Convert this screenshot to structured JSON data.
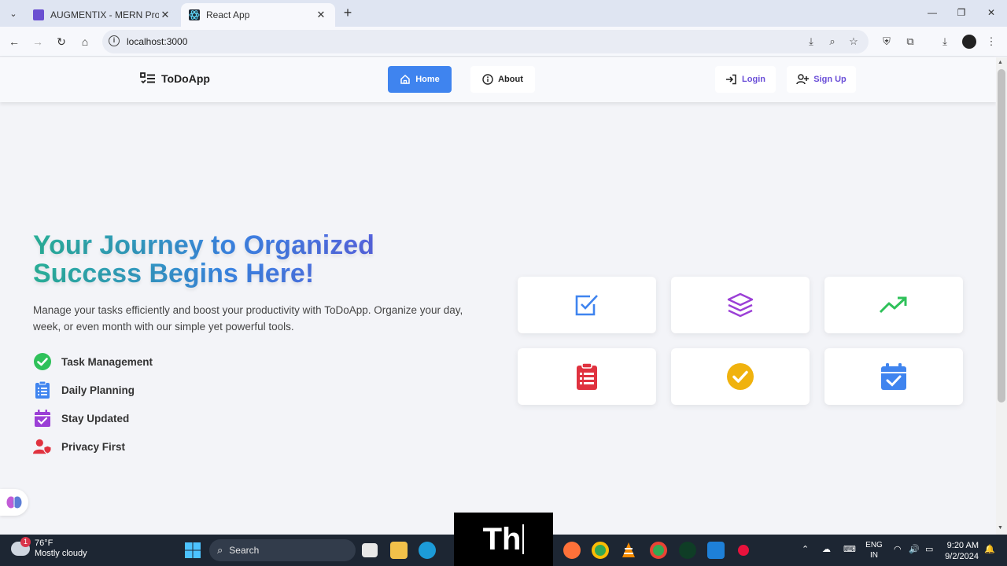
{
  "browser": {
    "tabs": [
      {
        "title": "AUGMENTIX - MERN Project Su",
        "active": false,
        "favicon_color": "#6a4fd1"
      },
      {
        "title": "React App",
        "active": true,
        "favicon_color": "#1e2a36"
      }
    ],
    "url": "localhost:3000"
  },
  "app": {
    "brand": "ToDoApp",
    "nav": {
      "home": "Home",
      "about": "About",
      "login": "Login",
      "signup": "Sign Up"
    },
    "hero": {
      "title": "Your Journey to Organized Success Begins Here!",
      "description": "Manage your tasks efficiently and boost your productivity with ToDoApp. Organize your day, week, or even month with our simple yet powerful tools.",
      "features": [
        {
          "label": "Task Management",
          "icon": "check-circle-icon",
          "color": "#2fc15a"
        },
        {
          "label": "Daily Planning",
          "icon": "clipboard-list-icon",
          "color": "#3f84ef"
        },
        {
          "label": "Stay Updated",
          "icon": "calendar-check-icon",
          "color": "#9b3fd6"
        },
        {
          "label": "Privacy First",
          "icon": "user-shield-icon",
          "color": "#e0323f"
        }
      ]
    },
    "cards": [
      {
        "icon": "checkbox-icon",
        "color": "#3f84ef"
      },
      {
        "icon": "layers-icon",
        "color": "#9b3fd6"
      },
      {
        "icon": "trending-up-icon",
        "color": "#2fc15a"
      },
      {
        "icon": "clipboard-list-icon",
        "color": "#e0323f"
      },
      {
        "icon": "check-circle-icon",
        "color": "#f0b20e"
      },
      {
        "icon": "calendar-check-icon",
        "color": "#3f84ef"
      }
    ]
  },
  "taskbar": {
    "weather": {
      "temp": "76°F",
      "condition": "Mostly cloudy",
      "badge": "1"
    },
    "search_placeholder": "Search",
    "language": {
      "line1": "ENG",
      "line2": "IN"
    },
    "time": "9:20 AM",
    "date": "9/2/2024"
  },
  "caption_text": "Th"
}
